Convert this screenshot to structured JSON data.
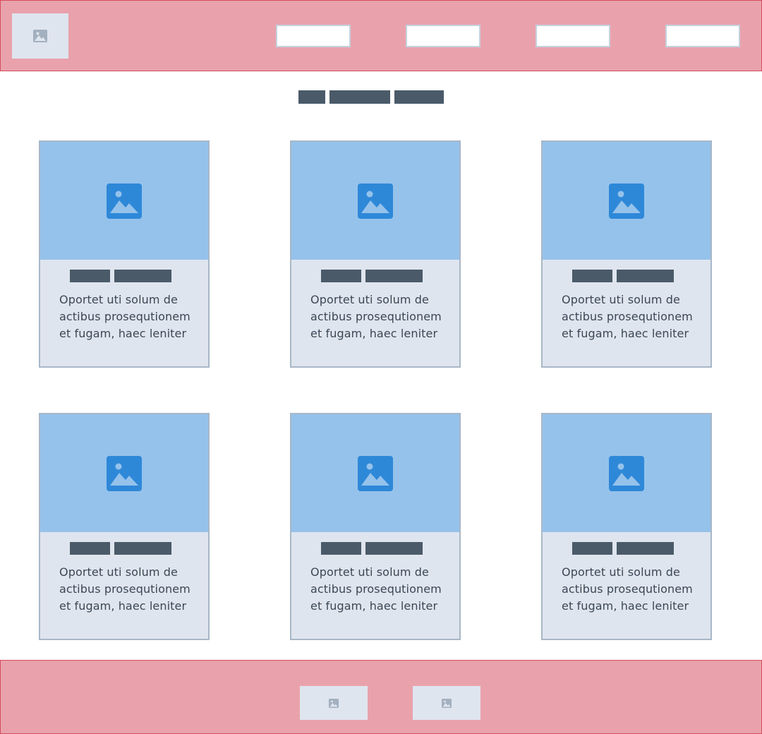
{
  "header": {
    "logo_icon": "image-icon",
    "nav_buttons": [
      "",
      "",
      "",
      ""
    ]
  },
  "cards": [
    {
      "icon": "image-icon",
      "text": "Oportet uti solum de actibus prosequtionem et fugam, haec leniter"
    },
    {
      "icon": "image-icon",
      "text": "Oportet uti solum de actibus prosequtionem et fugam, haec leniter"
    },
    {
      "icon": "image-icon",
      "text": "Oportet uti solum de actibus prosequtionem et fugam, haec leniter"
    },
    {
      "icon": "image-icon",
      "text": "Oportet uti solum de actibus prosequtionem et fugam, haec leniter"
    },
    {
      "icon": "image-icon",
      "text": "Oportet uti solum de actibus prosequtionem et fugam, haec leniter"
    },
    {
      "icon": "image-icon",
      "text": "Oportet uti solum de actibus prosequtionem et fugam, haec leniter"
    }
  ],
  "footer": {
    "images": [
      "image-icon",
      "image-icon"
    ]
  },
  "colors": {
    "header_bg": "#e9a2ab",
    "header_border": "#d64b5f",
    "card_image_bg": "#95c2eb",
    "card_icon": "#2e88d8",
    "card_bg": "#dfe5ee",
    "placeholder_bar": "#4a5a69"
  }
}
